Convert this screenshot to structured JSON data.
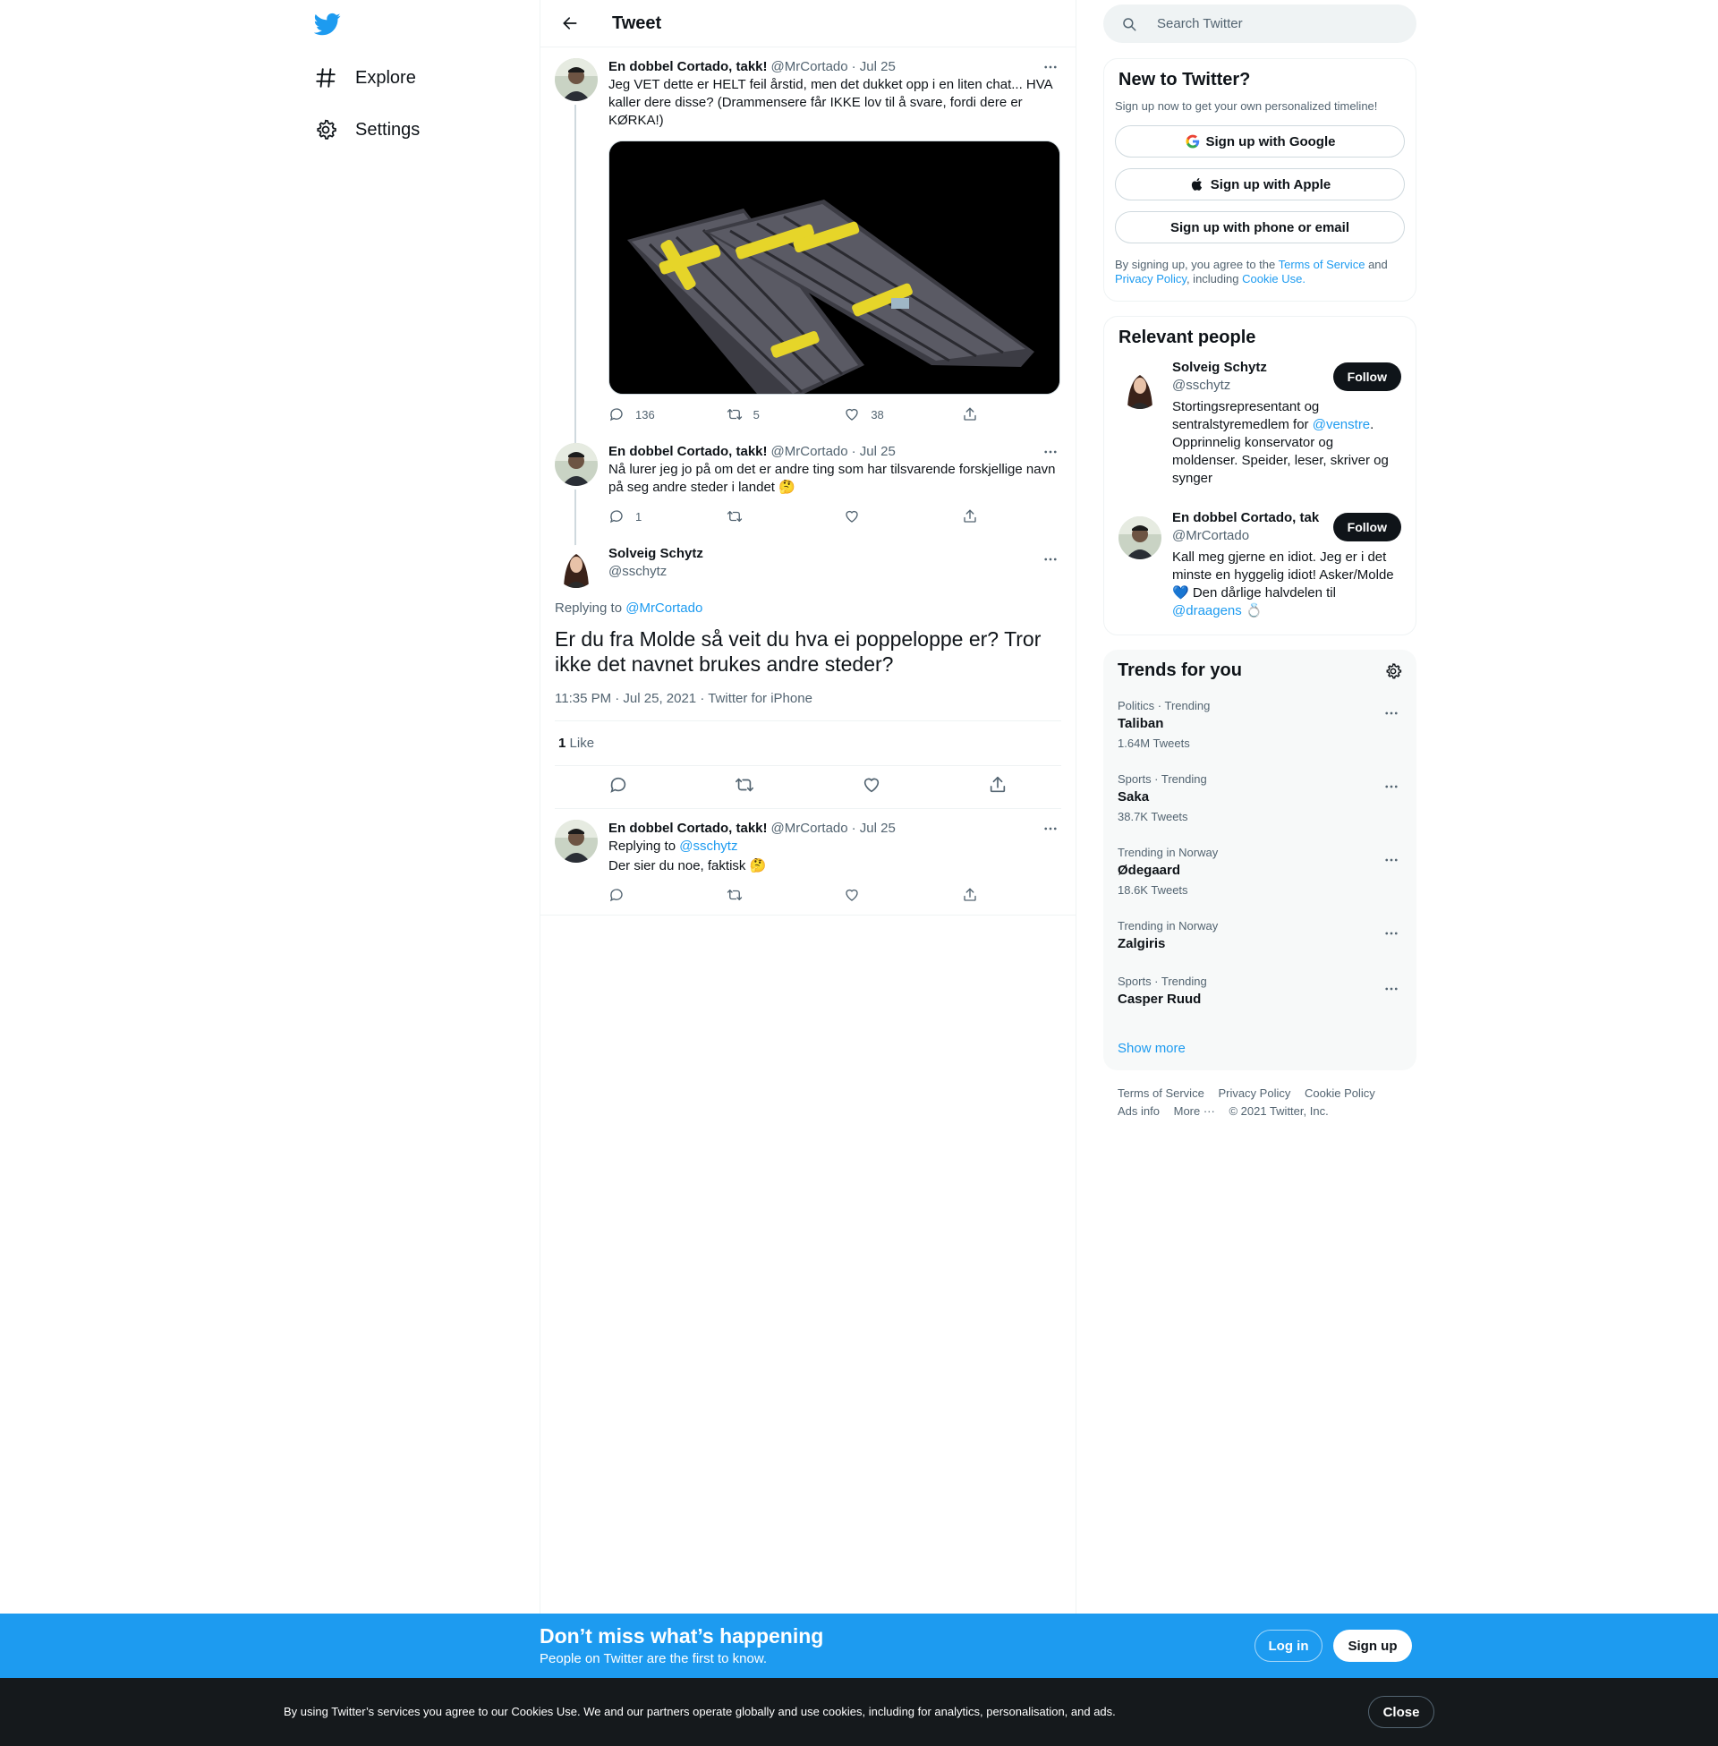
{
  "nav": {
    "logo": "twitter-bird-icon",
    "items": [
      {
        "label": "Explore",
        "icon": "hashtag-icon"
      },
      {
        "label": "Settings",
        "icon": "gear-icon"
      }
    ]
  },
  "header": {
    "title": "Tweet"
  },
  "thread": [
    {
      "name": "En dobbel Cortado, takk!",
      "handle": "@MrCortado",
      "date": "· Jul 25",
      "text": "Jeg VET dette er HELT feil årstid, men det dukket opp i en liten chat... HVA kaller dere disse? (Drammensere får IKKE lov til å svare, fordi dere er KØRKA!)",
      "replies": "136",
      "retweets": "5",
      "likes": "38"
    },
    {
      "name": "En dobbel Cortado, takk!",
      "handle": "@MrCortado",
      "date": "· Jul 25",
      "text": "Nå lurer jeg jo på om det er andre ting som har tilsvarende forskjellige navn på seg andre steder i landet 🤔",
      "replies": "1",
      "retweets": "",
      "likes": ""
    }
  ],
  "focused": {
    "name": "Solveig Schytz",
    "handle": "@sschytz",
    "replying_label": "Replying to",
    "replying_to": "@MrCortado",
    "text": "Er du fra Molde så veit du hva ei poppeloppe er? Tror ikke det navnet brukes andre steder?",
    "time": "11:35 PM · Jul 25, 2021 · Twitter for iPhone",
    "like_count": "1",
    "like_label": "Like"
  },
  "reply": {
    "name": "En dobbel Cortado, takk!",
    "handle": "@MrCortado",
    "date": "· Jul 25",
    "replying_label": "Replying to",
    "replying_to": "@sschytz",
    "text": "Der sier du noe, faktisk 🤔"
  },
  "search": {
    "placeholder": "Search Twitter"
  },
  "signup_card": {
    "title": "New to Twitter?",
    "subtitle": "Sign up now to get your own personalized timeline!",
    "google": "Sign up with Google",
    "apple": "Sign up with Apple",
    "phone": "Sign up with phone or email",
    "terms_pre": "By signing up, you agree to the",
    "terms_link": "Terms of Service",
    "terms_and": "and",
    "privacy_link": "Privacy Policy",
    "terms_including": ", including",
    "cookie_link": "Cookie Use."
  },
  "relevant": {
    "title": "Relevant people",
    "people": [
      {
        "name": "Solveig Schytz",
        "handle": "@sschytz",
        "bio_pre": "Stortingsrepresentant og sentralstyremedlem for",
        "bio_link": "@venstre",
        "bio_post": ". Opprinnelig konservator og moldenser. Speider, leser, skriver og synger",
        "follow": "Follow"
      },
      {
        "name": "En dobbel Cortado, tak",
        "handle": "@MrCortado",
        "bio_pre": "Kall meg gjerne en idiot. Jeg er i det minste en hyggelig idiot! Asker/Molde 💙 Den dårlige halvdelen til",
        "bio_link": "@draagens",
        "bio_post": " 💍",
        "follow": "Follow"
      }
    ]
  },
  "trends": {
    "title": "Trends for you",
    "items": [
      {
        "context": "Politics · Trending",
        "name": "Taliban",
        "count": "1.64M Tweets"
      },
      {
        "context": "Sports · Trending",
        "name": "Saka",
        "count": "38.7K Tweets"
      },
      {
        "context": "Trending in Norway",
        "name": "Ødegaard",
        "count": "18.6K Tweets"
      },
      {
        "context": "Trending in Norway",
        "name": "Zalgiris",
        "count": ""
      },
      {
        "context": "Sports · Trending",
        "name": "Casper Ruud",
        "count": ""
      }
    ],
    "show_more": "Show more"
  },
  "footer": {
    "links": [
      "Terms of Service",
      "Privacy Policy",
      "Cookie Policy",
      "Ads info",
      "More ···",
      "© 2021 Twitter, Inc."
    ]
  },
  "banner": {
    "title": "Don’t miss what’s happening",
    "subtitle": "People on Twitter are the first to know.",
    "login": "Log in",
    "signup": "Sign up"
  },
  "cookie": {
    "text": "By using Twitter’s services you agree to our Cookies Use. We and our partners operate globally and use cookies, including for analytics, personalisation, and ads.",
    "close": "Close"
  },
  "colors": {
    "accent": "#1d9bf0",
    "text": "#0f1419",
    "muted": "#536471",
    "cookie_bg": "#15191c"
  }
}
